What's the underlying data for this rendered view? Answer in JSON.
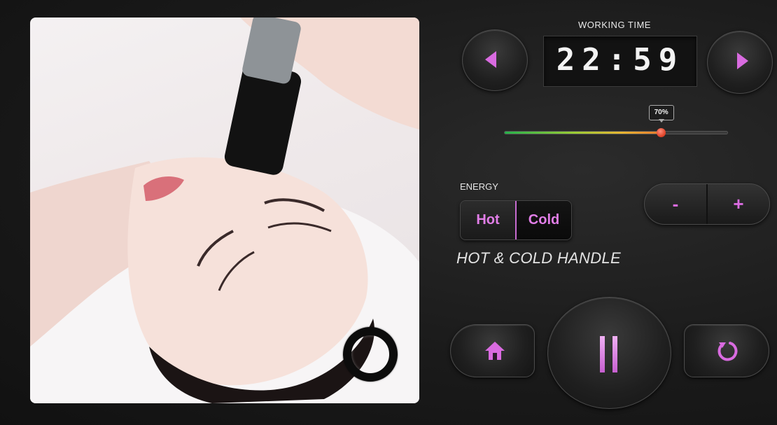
{
  "timer": {
    "label": "WORKING TIME",
    "value": "22:59"
  },
  "intensity": {
    "percent": 70,
    "label": "70%"
  },
  "energy": {
    "label": "ENERGY",
    "options": [
      "Hot",
      "Cold"
    ],
    "selected": "Cold"
  },
  "adjust": {
    "minus": "-",
    "plus": "+"
  },
  "handle_title": "HOT & COLD  HANDLE",
  "icons": {
    "prev": "triangle-left-icon",
    "next": "triangle-right-icon",
    "home": "home-icon",
    "pause": "pause-icon",
    "refresh": "refresh-icon",
    "handle_ring": "ring-icon"
  },
  "colors": {
    "accent": "#d96be0",
    "background": "#1a1a1a",
    "slider_start": "#26b24a",
    "slider_end": "#e87a2e",
    "slider_thumb": "#e2482d"
  }
}
